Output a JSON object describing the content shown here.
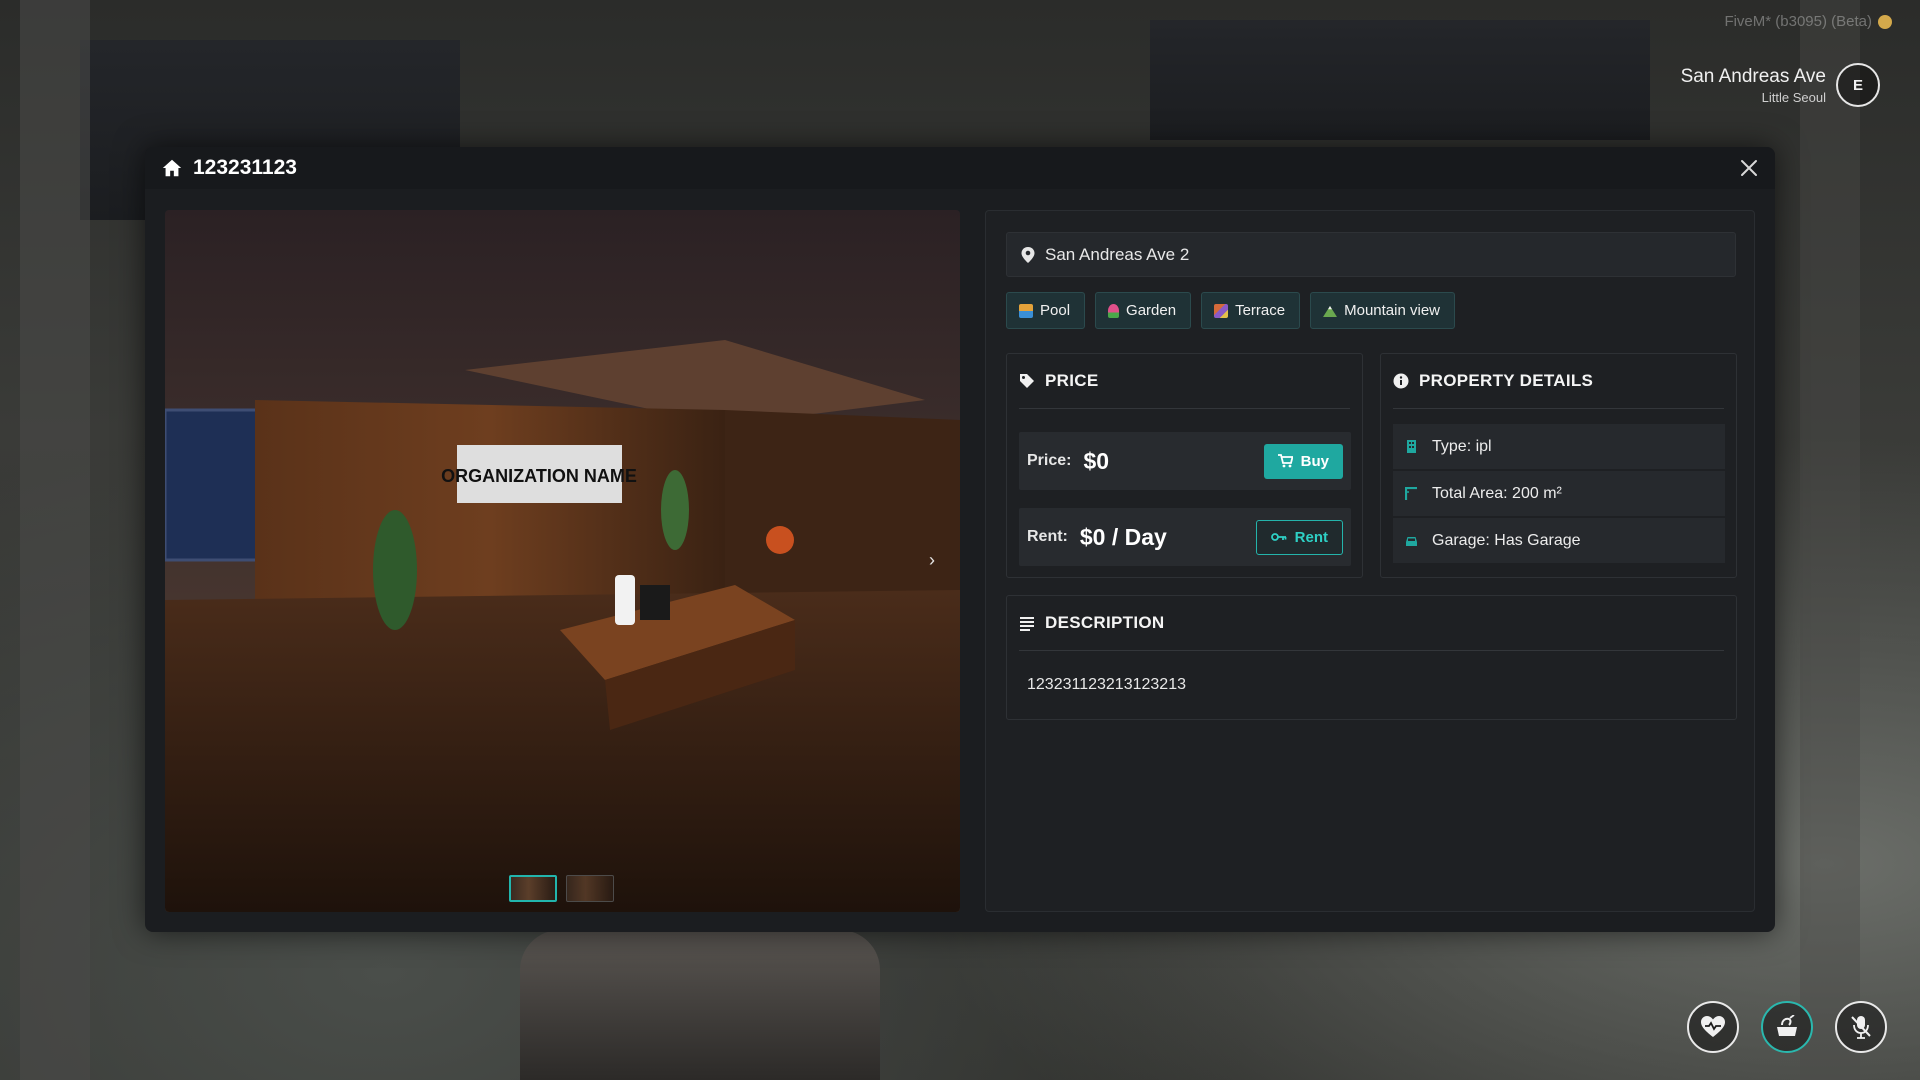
{
  "watermark": {
    "text": "FiveM* (b3095) (Beta)"
  },
  "location": {
    "street": "San Andreas Ave",
    "area": "Little Seoul",
    "compass": "E"
  },
  "modal": {
    "title": "123231123",
    "icon": "home-icon",
    "close_icon": "close-icon"
  },
  "gallery": {
    "sign_text": "ORGANIZATION NAME",
    "next_icon": "›",
    "thumbnail_count": 2,
    "active_thumbnail": 1
  },
  "property": {
    "address": "San Andreas Ave 2",
    "tags": [
      {
        "label": "Pool",
        "icon": "pool-icon",
        "color": "#e2a23a"
      },
      {
        "label": "Garden",
        "icon": "tulip-icon",
        "color": "#e0508a"
      },
      {
        "label": "Terrace",
        "icon": "terrace-icon",
        "color": "#d46a3a"
      },
      {
        "label": "Mountain view",
        "icon": "mountain-icon",
        "color": "#6aa84f"
      }
    ],
    "price": {
      "heading": "PRICE",
      "buy_label": "Price:",
      "buy_value": "$0",
      "buy_button": "Buy",
      "rent_label": "Rent:",
      "rent_value": "$0 / Day",
      "rent_button": "Rent"
    },
    "details": {
      "heading": "PROPERTY DETAILS",
      "rows": [
        {
          "text": "Type: ipl",
          "icon": "building-icon"
        },
        {
          "text": "Total Area: 200 m²",
          "icon": "area-icon"
        },
        {
          "text": "Garage: Has Garage",
          "icon": "car-icon"
        }
      ]
    },
    "description": {
      "heading": "DESCRIPTION",
      "text": "123231123213123213"
    }
  },
  "hud": [
    {
      "icon": "heart-icon"
    },
    {
      "icon": "food-icon"
    },
    {
      "icon": "microphone-muted-icon"
    }
  ],
  "colors": {
    "accent": "#1fa8a0",
    "panel": "#1b1d20"
  }
}
